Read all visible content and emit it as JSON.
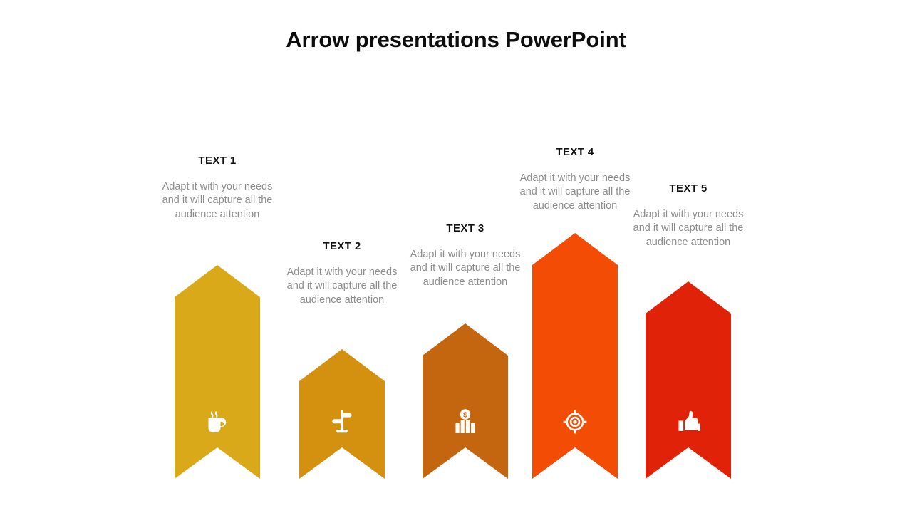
{
  "slide": {
    "title": "Arrow presentations PowerPoint",
    "background_color": "#ffffff",
    "title_color": "#0d0d0d",
    "body_text_color": "#8d8d8d"
  },
  "items": [
    {
      "label": "TEXT 1",
      "body": "Adapt it with your needs and it will capture all the audience attention",
      "color": "#D9A91A",
      "icon": "coffee-cup-icon"
    },
    {
      "label": "TEXT 2",
      "body": "Adapt it with your needs and it will capture all the audience attention",
      "color": "#D4900F",
      "icon": "signpost-icon"
    },
    {
      "label": "TEXT 3",
      "body": "Adapt it with your needs and it will capture all the audience attention",
      "color": "#C4650F",
      "icon": "money-bar-chart-icon"
    },
    {
      "label": "TEXT 4",
      "body": "Adapt it with your needs and it will capture all the audience attention",
      "color": "#F24C05",
      "icon": "target-icon"
    },
    {
      "label": "TEXT 5",
      "body": "Adapt it with your needs and it will capture all the audience attention",
      "color": "#E02209",
      "icon": "thumbs-up-icon"
    }
  ]
}
